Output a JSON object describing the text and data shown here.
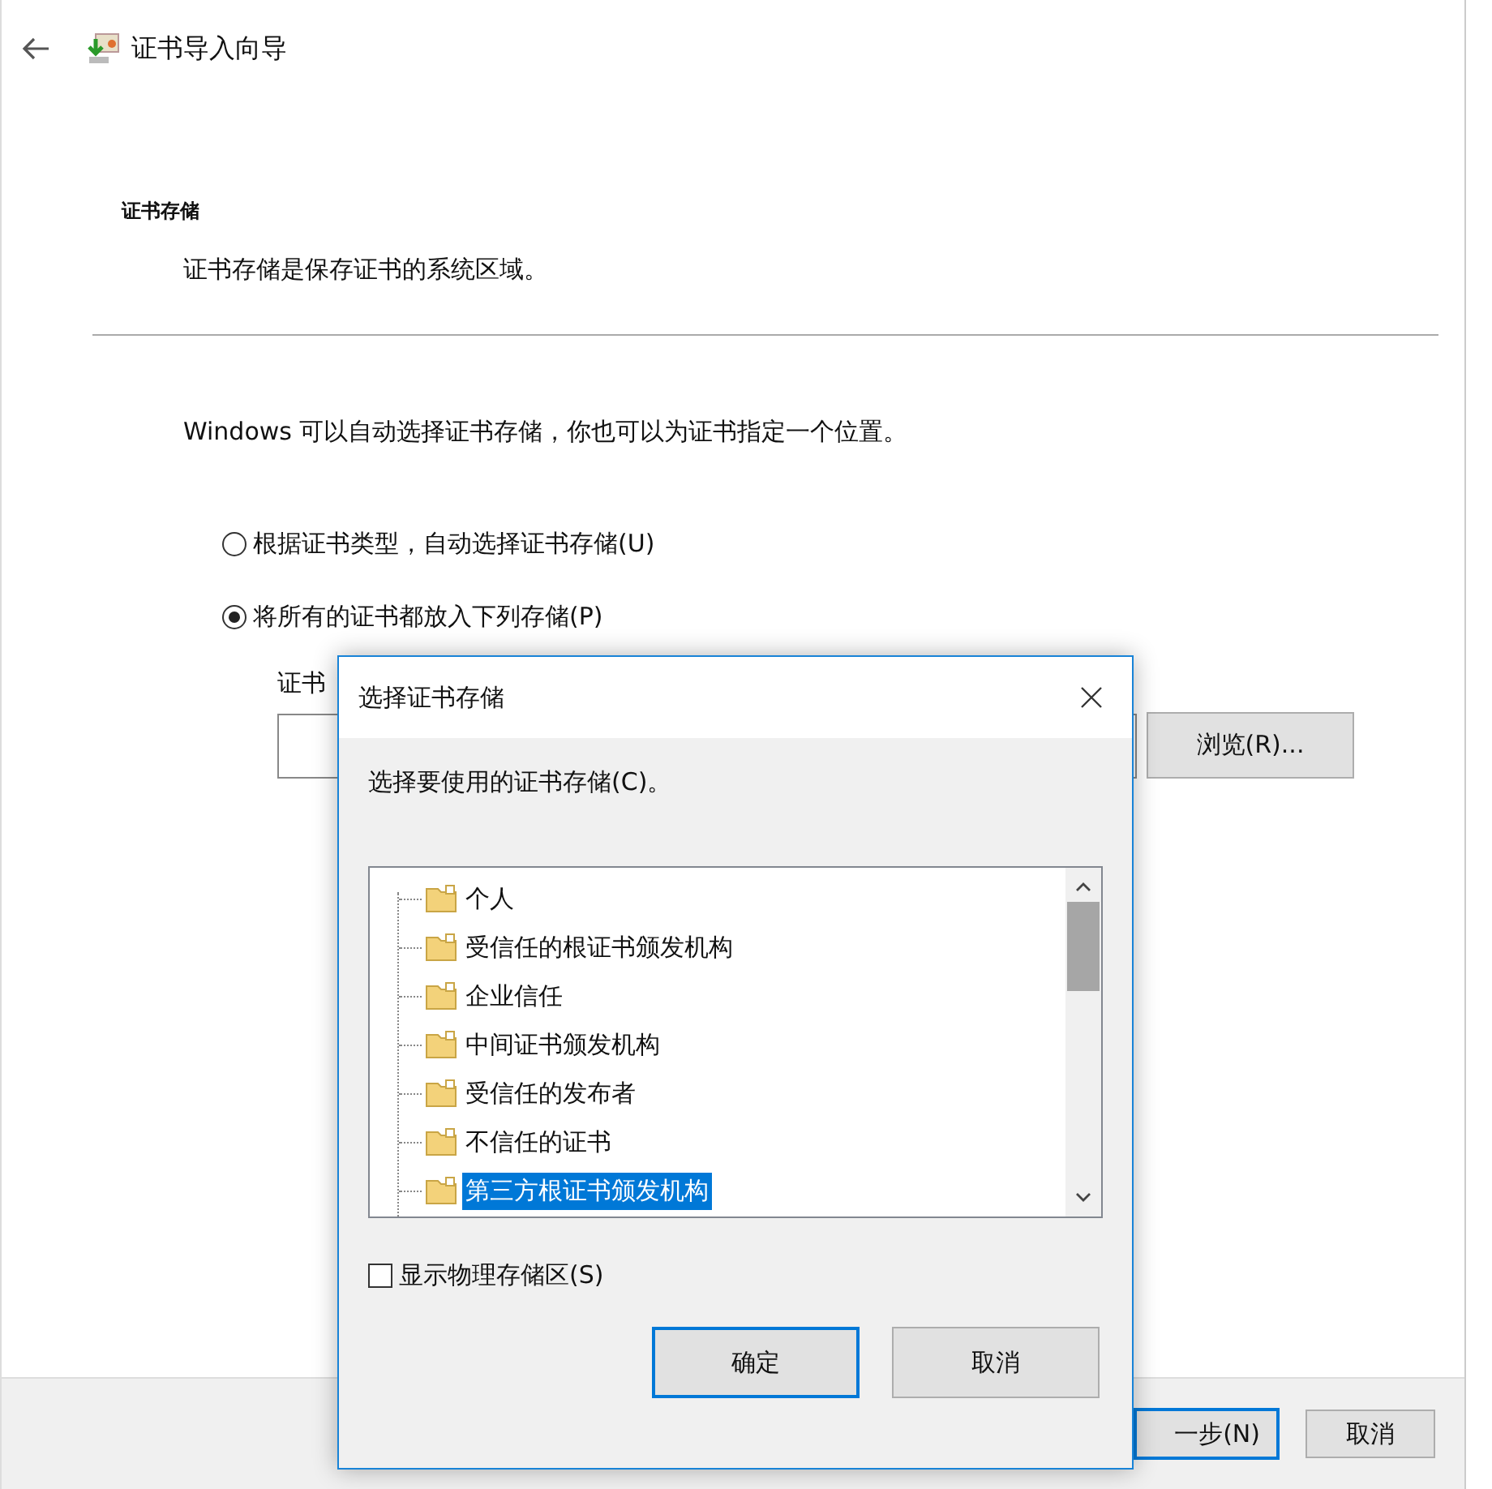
{
  "wizard": {
    "title": "证书导入向导",
    "heading": "证书存储",
    "subheading": "证书存储是保存证书的系统区域。",
    "intro": "Windows 可以自动选择证书存储，你也可以为证书指定一个位置。",
    "options": [
      {
        "label": "根据证书类型，自动选择证书存储(U)",
        "selected": false
      },
      {
        "label": "将所有的证书都放入下列存储(P)",
        "selected": true
      }
    ],
    "store_label": "证书",
    "browse_button": "浏览(R)...",
    "next_button": "一步(N)",
    "cancel_button": "取消"
  },
  "dialog": {
    "title": "选择证书存储",
    "prompt": "选择要使用的证书存储(C)。",
    "stores": [
      {
        "label": "个人",
        "selected": false
      },
      {
        "label": "受信任的根证书颁发机构",
        "selected": false
      },
      {
        "label": "企业信任",
        "selected": false
      },
      {
        "label": "中间证书颁发机构",
        "selected": false
      },
      {
        "label": "受信任的发布者",
        "selected": false
      },
      {
        "label": "不信任的证书",
        "selected": false
      },
      {
        "label": "第三方根证书颁发机构",
        "selected": true
      }
    ],
    "show_physical": {
      "label": "显示物理存储区(S)",
      "checked": false
    },
    "ok_button": "确定",
    "cancel_button": "取消"
  }
}
